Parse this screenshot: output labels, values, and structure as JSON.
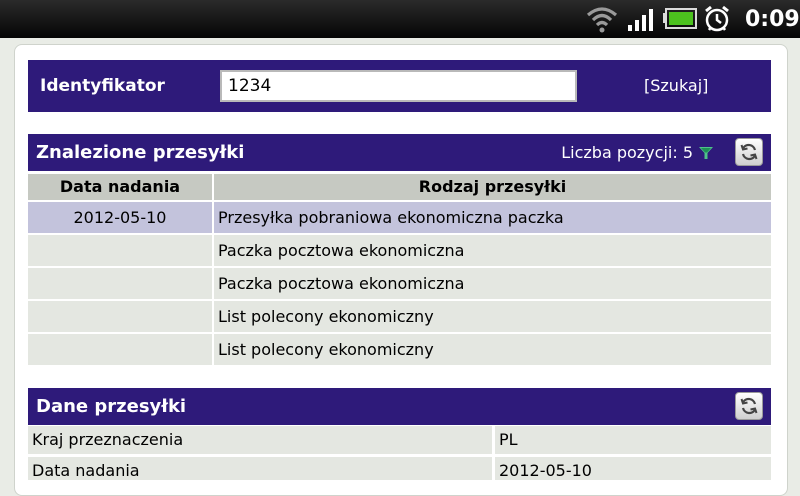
{
  "status_bar": {
    "time": "0:09",
    "icons": [
      "wifi-icon",
      "signal-icon",
      "battery-icon",
      "alarm-icon"
    ]
  },
  "search": {
    "label": "Identyfikator",
    "value": "1234",
    "button_label": "[Szukaj]"
  },
  "found": {
    "title": "Znalezione przesyłki",
    "count_label": "Liczba pozycji: 5",
    "columns": [
      "Data nadania",
      "Rodzaj przesyłki"
    ],
    "rows": [
      {
        "date": "2012-05-10",
        "type": "Przesyłka pobraniowa ekonomiczna paczka",
        "selected": true
      },
      {
        "date": "",
        "type": "Paczka pocztowa ekonomiczna",
        "selected": false
      },
      {
        "date": "",
        "type": "Paczka pocztowa ekonomiczna",
        "selected": false
      },
      {
        "date": "",
        "type": "List polecony ekonomiczny",
        "selected": false
      },
      {
        "date": "",
        "type": "List polecony ekonomiczny",
        "selected": false
      }
    ]
  },
  "details": {
    "title": "Dane przesyłki",
    "rows": [
      {
        "label": "Kraj przeznaczenia",
        "value": "PL"
      },
      {
        "label": "Data nadania",
        "value": "2012-05-10"
      }
    ]
  },
  "colors": {
    "header_bg": "#2e1a7a",
    "row_bg": "#e4e7e1",
    "selected_row_bg": "#c3c3dc",
    "column_header_bg": "#c6c9c2"
  }
}
